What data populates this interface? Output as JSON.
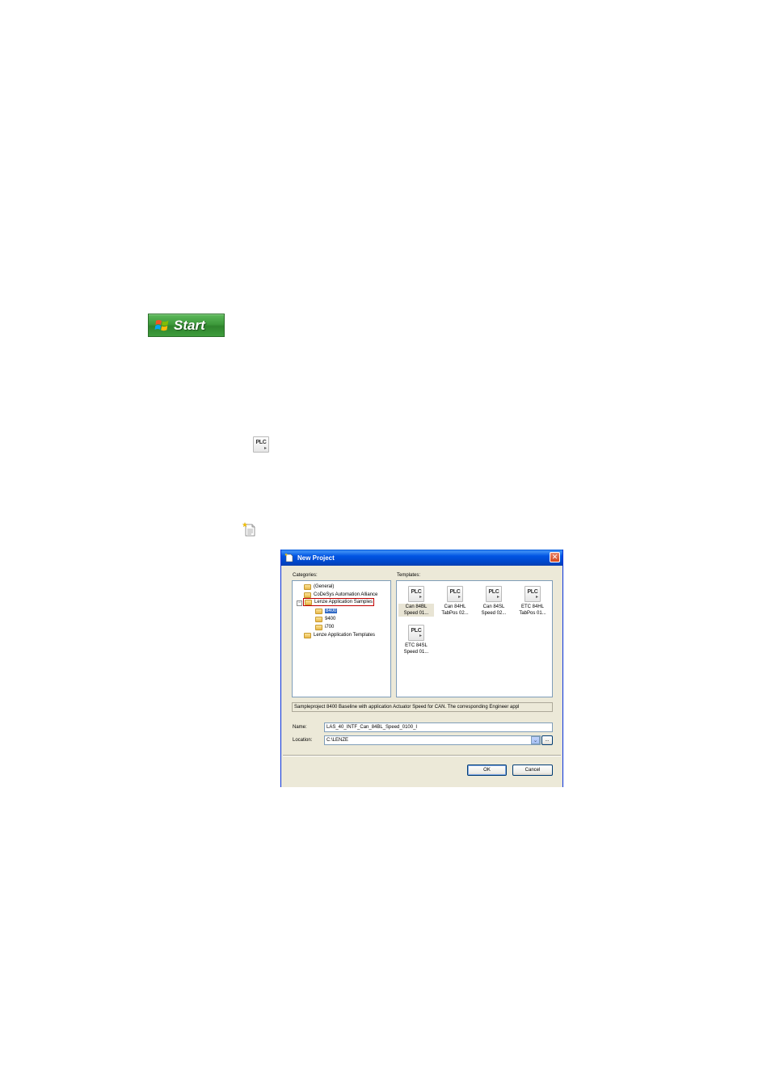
{
  "start_button": {
    "label": "Start"
  },
  "dialog": {
    "title": "New Project",
    "categories_label": "Categories:",
    "templates_label": "Templates:",
    "categories": [
      {
        "label": "(General)",
        "level": 0,
        "selected": false
      },
      {
        "label": "CoDeSys Automation Alliance",
        "level": 0,
        "selected": false
      },
      {
        "label": "Lenze Application Samples",
        "level": 0,
        "selected": false,
        "expanded": true,
        "highlighted": true
      },
      {
        "label": "8400",
        "level": 1,
        "selected": true
      },
      {
        "label": "9400",
        "level": 1,
        "selected": false
      },
      {
        "label": "i700",
        "level": 1,
        "selected": false
      },
      {
        "label": "Lenze Application Templates",
        "level": 0,
        "selected": false
      }
    ],
    "templates": [
      {
        "icon": "PLC",
        "line1": "Can 84BL",
        "line2": "Speed 01...",
        "selected": true
      },
      {
        "icon": "PLC",
        "line1": "Can 84HL",
        "line2": "TabPos 02...",
        "selected": false
      },
      {
        "icon": "PLC",
        "line1": "Can 84SL",
        "line2": "Speed 02...",
        "selected": false
      },
      {
        "icon": "PLC",
        "line1": "ETC 84HL",
        "line2": "TabPos 01...",
        "selected": false
      },
      {
        "icon": "PLC",
        "line1": "ETC 84SL",
        "line2": "Speed 01...",
        "selected": false
      }
    ],
    "description": "Sampleproject 8400 Baseline with application Actuator Speed for CAN. The corresponding Engineer appl",
    "name_label": "Name:",
    "name_value": "LAS_40_INTF_Can_84BL_Speed_0100_I",
    "location_label": "Location:",
    "location_value": "C:\\LENZE",
    "browse_label": "...",
    "ok_label": "OK",
    "cancel_label": "Cancel"
  },
  "plc_icon_text": "PLC"
}
